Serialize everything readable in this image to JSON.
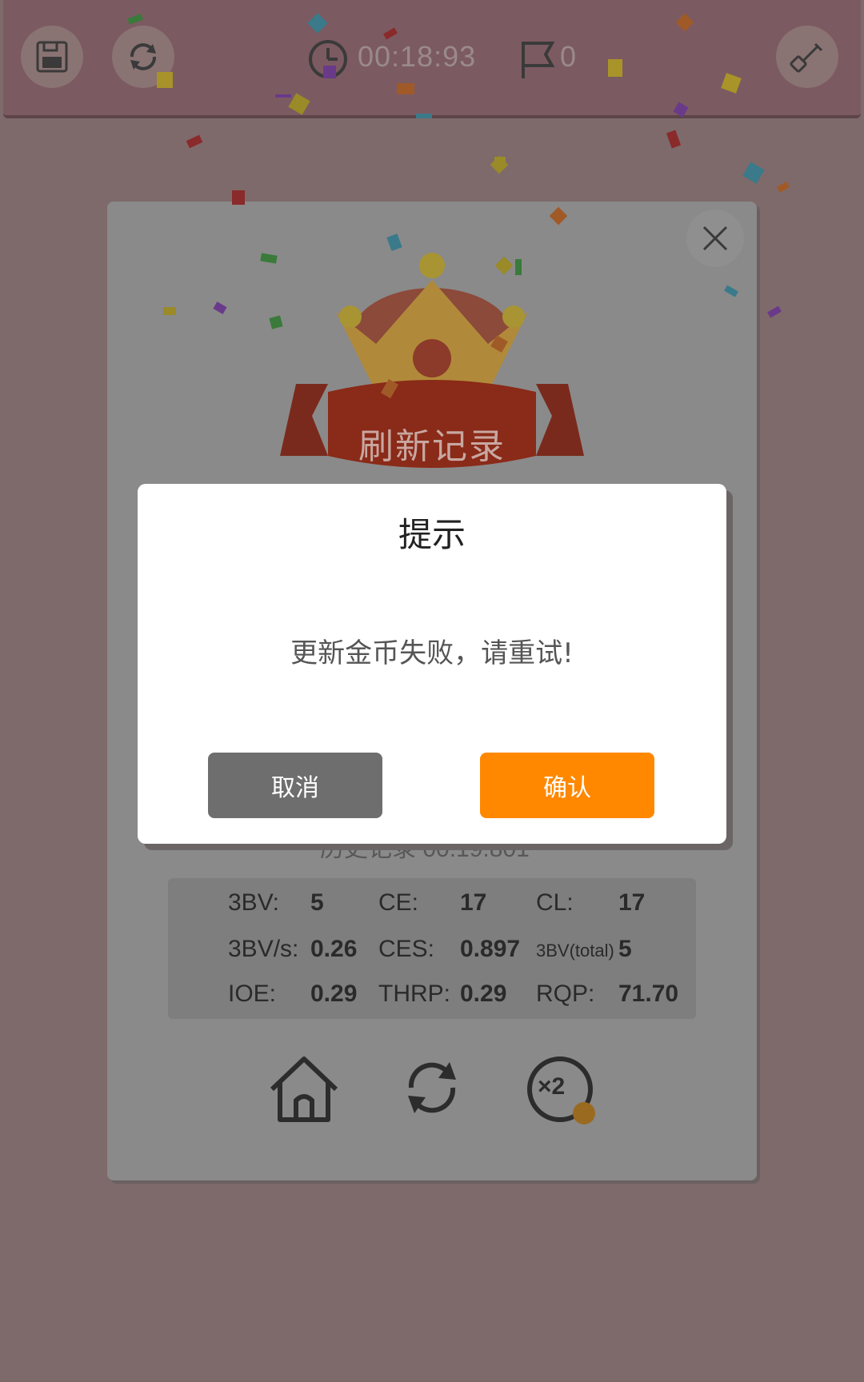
{
  "topbar": {
    "timer": "00:18:93",
    "flags": "0",
    "buttons": [
      {
        "icon": "save-icon"
      },
      {
        "icon": "refresh-icon"
      },
      {
        "icon": "shovel-icon"
      }
    ]
  },
  "result": {
    "banner": "刷新记录",
    "history": "历史记录 00:19.801",
    "stats": [
      {
        "label": "3BV:",
        "value": "5"
      },
      {
        "label": "CE:",
        "value": "17"
      },
      {
        "label": "CL:",
        "value": "17"
      },
      {
        "label": "3BV/s:",
        "value": "0.26"
      },
      {
        "label": "CES:",
        "value": "0.897"
      },
      {
        "label": "3BV(total)",
        "value": "5"
      },
      {
        "label": "IOE:",
        "value": "0.29"
      },
      {
        "label": "THRP:",
        "value": "0.29"
      },
      {
        "label": "RQP:",
        "value": "71.70"
      }
    ],
    "bottom_icons": [
      "home-icon",
      "restart-icon",
      "double-coin-icon"
    ],
    "double_label": "×2"
  },
  "dialog": {
    "title": "提示",
    "message": "更新金币失败，请重试!",
    "cancel": "取消",
    "confirm": "确认"
  },
  "colors": {
    "confirm": "#ff8800",
    "cancel": "#6e6e6e"
  }
}
